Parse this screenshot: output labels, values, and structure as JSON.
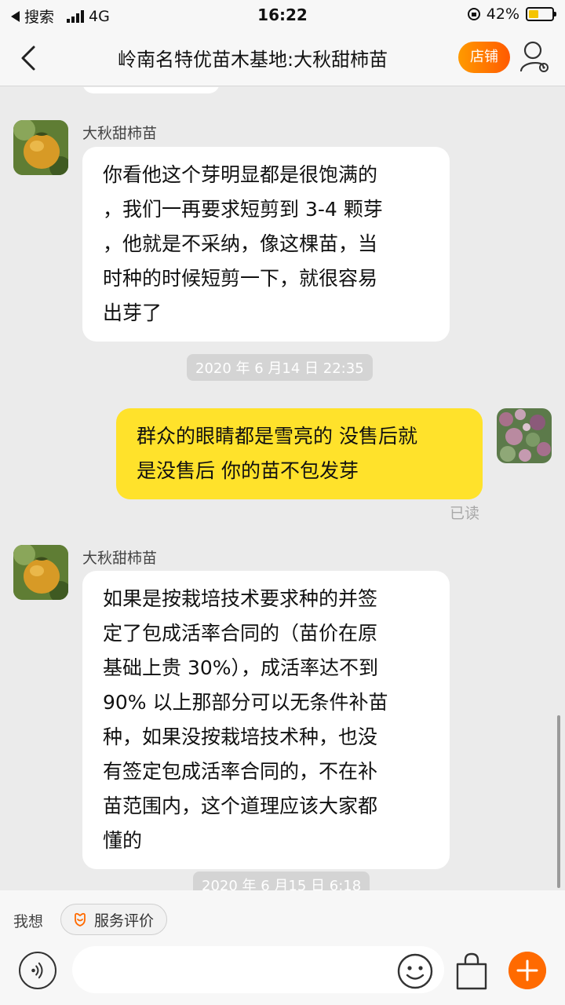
{
  "status_bar": {
    "back_label": "搜索",
    "network": "4G",
    "time": "16:22",
    "battery": "42%",
    "battery_level": 0.42,
    "icons": [
      "back-to-app-icon",
      "signal-icon",
      "orientation-lock-icon",
      "battery-icon"
    ]
  },
  "nav": {
    "title": "岭南名特优苗木基地:大秋甜柿苗",
    "shop_label": "店铺",
    "icons": [
      "back-chevron-icon",
      "user-settings-icon"
    ],
    "accent_colors": [
      "#ff9a00",
      "#ff5a00"
    ]
  },
  "messages": [
    {
      "side": "left",
      "sender": "大秋甜柿苗",
      "lines": [
        "你看他这个芽明显都是很饱满的",
        "，我们一再要求短剪到 3-4 颗芽",
        "，他就是不采纳，像这棵苗，当",
        "时种的时候短剪一下，就很容易",
        "出芽了"
      ]
    },
    {
      "type": "timestamp",
      "text": "2020 年 6 月14 日 22:35"
    },
    {
      "side": "right",
      "lines": [
        "群众的眼睛都是雪亮的 没售后就",
        "是没售后 你的苗不包发芽"
      ],
      "status": "已读",
      "bubble_color": "#ffe22b"
    },
    {
      "side": "left",
      "sender": "大秋甜柿苗",
      "lines": [
        "如果是按栽培技术要求种的并签",
        "定了包成活率合同的（苗价在原",
        "基础上贵 30%），成活率达不到",
        "90% 以上那部分可以无条件补苗",
        "种，如果没按栽培技术种，也没",
        "有签定包成活率合同的，不在补",
        "苗范围内，这个道理应该大家都",
        "懂的"
      ]
    },
    {
      "type": "timestamp",
      "text": "2020 年 6 月15 日 6:18"
    }
  ],
  "quick_bar": {
    "label": "我想",
    "chip_label": "服务评价",
    "chip_icon": "service-review-icon"
  },
  "input_bar": {
    "placeholder": "",
    "icons": [
      "voice-icon",
      "emoji-icon",
      "shopping-bag-icon",
      "plus-icon"
    ]
  }
}
